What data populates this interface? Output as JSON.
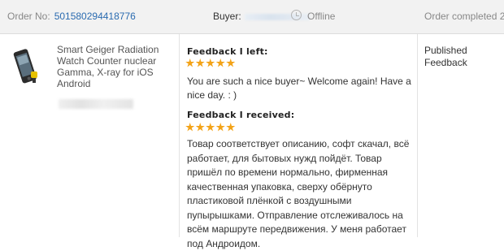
{
  "header": {
    "order_label": "Order No:",
    "order_number": "501580294418776",
    "buyer_label": "Buyer:",
    "buyer_status": "Offline",
    "order_status": "Order completed 2"
  },
  "product": {
    "title": "Smart Geiger Radiation Watch Counter nuclear Gamma, X-ray for iOS Android",
    "image_icon": "phone-geiger-image"
  },
  "feedback_left": {
    "heading": "Feedback I left:",
    "stars": 5,
    "text": "You are such a nice buyer~ Welcome again! Have a nice day. : )"
  },
  "feedback_received": {
    "heading": "Feedback I received:",
    "stars": 5,
    "text": "Товар соответствует описанию, софт скачал, всё работает, для бытовых нужд пойдёт. Товар пришёл по времени нормально, фирменная качественная упаковка, сверху обёрнуто пластиковой плёнкой с воздушными пупырышками. Отправление отслеживалось на всём маршруте передвижения. У меня работает под Андроидом."
  },
  "status": {
    "line1": "Published",
    "line2": "Feedback"
  },
  "colors": {
    "link": "#2a6bb0",
    "star": "#f3a318",
    "header_bg": "#f2f2f2"
  }
}
